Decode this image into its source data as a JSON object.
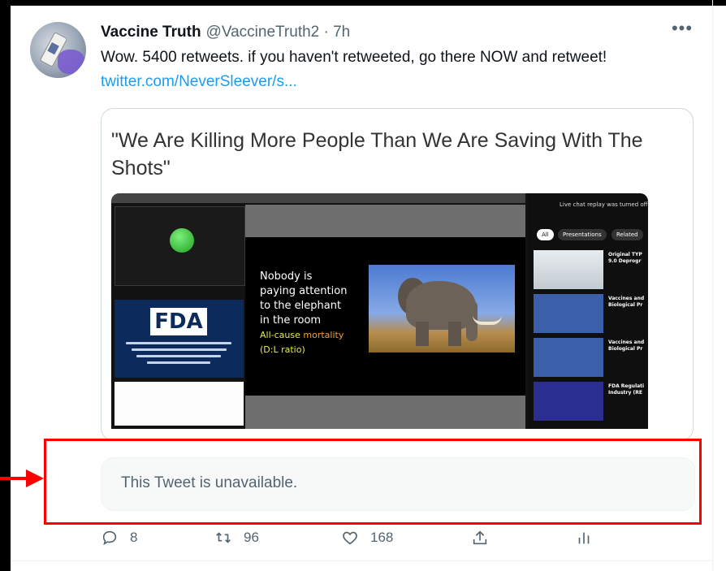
{
  "tweet": {
    "author_name": "Vaccine Truth",
    "handle_time": "@VaccineTruth2 · 7h",
    "more_icon": "more-icon",
    "text": "Wow. 5400 retweets. if you haven't retweeted, go there NOW and retweet!",
    "link": "twitter.com/NeverSleever/s..."
  },
  "card": {
    "title": "\"We Are Killing More People Than We Are Saving With The Shots\""
  },
  "video": {
    "fda_logo": "FDA",
    "slide_lines": [
      "Nobody is",
      "paying attention",
      "to the elephant",
      "in the room"
    ],
    "slide_highlight_1": "All-cause",
    "slide_highlight_2": "mortality",
    "slide_highlight_3": "(D:L ratio)",
    "chat_note": "Live chat replay was turned off",
    "chips": [
      "All",
      "Presentations",
      "Related"
    ],
    "related": [
      {
        "title": "Original TYP\n9.0 Deprogr"
      },
      {
        "title": "Vaccines and\nBiological Pr"
      },
      {
        "title": "Vaccines and\nBiological Pr"
      },
      {
        "title": "FDA Regulati\nIndustry (RE"
      }
    ]
  },
  "quoted": {
    "unavailable_text": "This Tweet is unavailable."
  },
  "actions": {
    "reply_count": "8",
    "retweet_count": "96",
    "like_count": "168"
  },
  "colors": {
    "accent_blue": "#1d9bf0",
    "annotation_red": "#ff0000",
    "secondary_text": "#536471"
  }
}
